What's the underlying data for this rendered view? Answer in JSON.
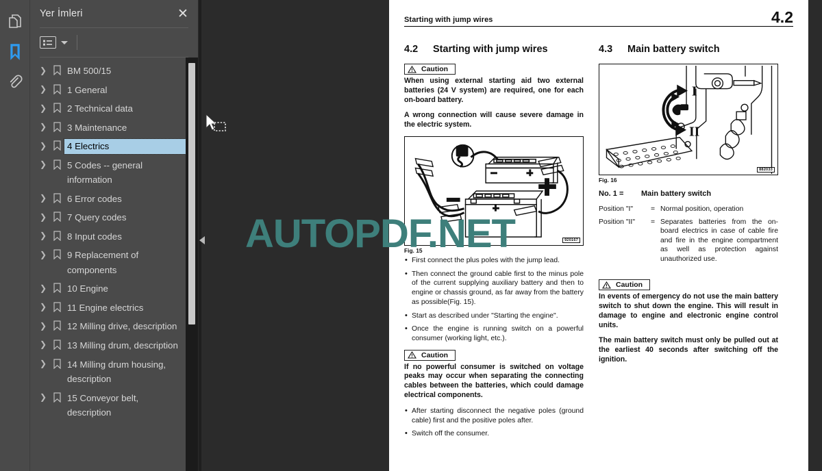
{
  "rail": {
    "items": [
      {
        "name": "pages-icon",
        "label": "Pages"
      },
      {
        "name": "bookmark-icon",
        "label": "Bookmarks",
        "active": true
      },
      {
        "name": "attachment-icon",
        "label": "Attachments"
      }
    ]
  },
  "panel": {
    "title": "Yer İmleri",
    "close_label": "✕",
    "toolbar": {
      "options_icon": "list-options-icon",
      "caret_icon": "chevron-down-icon"
    },
    "items": [
      {
        "label": "BM 500/15",
        "selected": false
      },
      {
        "label": "1 General",
        "selected": false
      },
      {
        "label": "2 Technical data",
        "selected": false
      },
      {
        "label": "3 Maintenance",
        "selected": false
      },
      {
        "label": "4 Electrics",
        "selected": true
      },
      {
        "label": "5 Codes -- general information",
        "selected": false
      },
      {
        "label": "6 Error codes",
        "selected": false
      },
      {
        "label": "7 Query codes",
        "selected": false
      },
      {
        "label": "8 Input codes",
        "selected": false
      },
      {
        "label": "9 Replacement of components",
        "selected": false
      },
      {
        "label": "10 Engine",
        "selected": false
      },
      {
        "label": "11 Engine electrics",
        "selected": false
      },
      {
        "label": "12 Milling drive, description",
        "selected": false
      },
      {
        "label": "13 Milling drum, description",
        "selected": false
      },
      {
        "label": "14 Milling drum housing, description",
        "selected": false
      },
      {
        "label": "15 Conveyor belt, description",
        "selected": false
      }
    ],
    "twisty_glyph": "❯",
    "collapse_handle": "◀"
  },
  "document": {
    "running_head": {
      "title": "Starting with jump wires",
      "page_number": "4.2"
    },
    "left_column": {
      "section": {
        "number": "4.2",
        "title": "Starting with jump wires"
      },
      "caution1": {
        "label": "Caution",
        "paragraphs": [
          "When using external starting aid two external batteries (24 V system) are required, one for each on-board battery.",
          "A wrong connection will cause severe damage in the electric system."
        ]
      },
      "figure": {
        "caption": "Fig. 15",
        "code": "920167"
      },
      "bullets1": [
        "First connect the plus poles with the jump lead.",
        "Then connect the ground cable first to the minus pole of the current supplying auxiliary battery and then to engine or chassis ground, as far away from the battery as possible(Fig. 15).",
        "Start as described under \"Starting the engine\".",
        "Once the engine is running switch on a powerful consumer (working light, etc.)."
      ],
      "caution2": {
        "label": "Caution",
        "paragraphs": [
          "If no powerful consumer is switched on voltage peaks may occur when separating the connecting cables between the batteries, which could damage electrical components."
        ],
        "bullets": [
          "After starting disconnect the negative poles (ground cable) first and the positive poles after.",
          "Switch off the consumer."
        ]
      }
    },
    "right_column": {
      "section": {
        "number": "4.3",
        "title": "Main battery switch"
      },
      "figure": {
        "caption": "Fig. 16",
        "code": "882033",
        "labels": [
          "I",
          "II"
        ]
      },
      "key": {
        "title_key": "No. 1 =",
        "title_value": "Main battery switch",
        "rows": [
          {
            "key": "Position \"I\"",
            "eq": "=",
            "value": "Normal position, operation"
          },
          {
            "key": "Position \"II\"",
            "eq": "=",
            "value": "Separates batteries from the on-board electrics in case of cable fire and fire in the engine compartment as well as protection against unauthorized use."
          }
        ]
      },
      "caution": {
        "label": "Caution",
        "paragraphs": [
          "In events of emergency do not use the main battery switch to shut down the engine. This will result in damage to engine and electronic engine control units.",
          "The main battery switch must only be pulled out at the earliest 40 seconds after switching off the ignition."
        ]
      }
    }
  },
  "watermark": {
    "text": "AUTOPDF.NET",
    "color": "#3e7f7b"
  },
  "cursor": {
    "name": "marquee-select-cursor"
  },
  "colors": {
    "panel_bg": "#4a4a4a",
    "viewer_bg": "#2b2b2b",
    "accent_blue": "#2e9bf0",
    "selection_blue": "#a8cee6",
    "page_white": "#ffffff"
  }
}
